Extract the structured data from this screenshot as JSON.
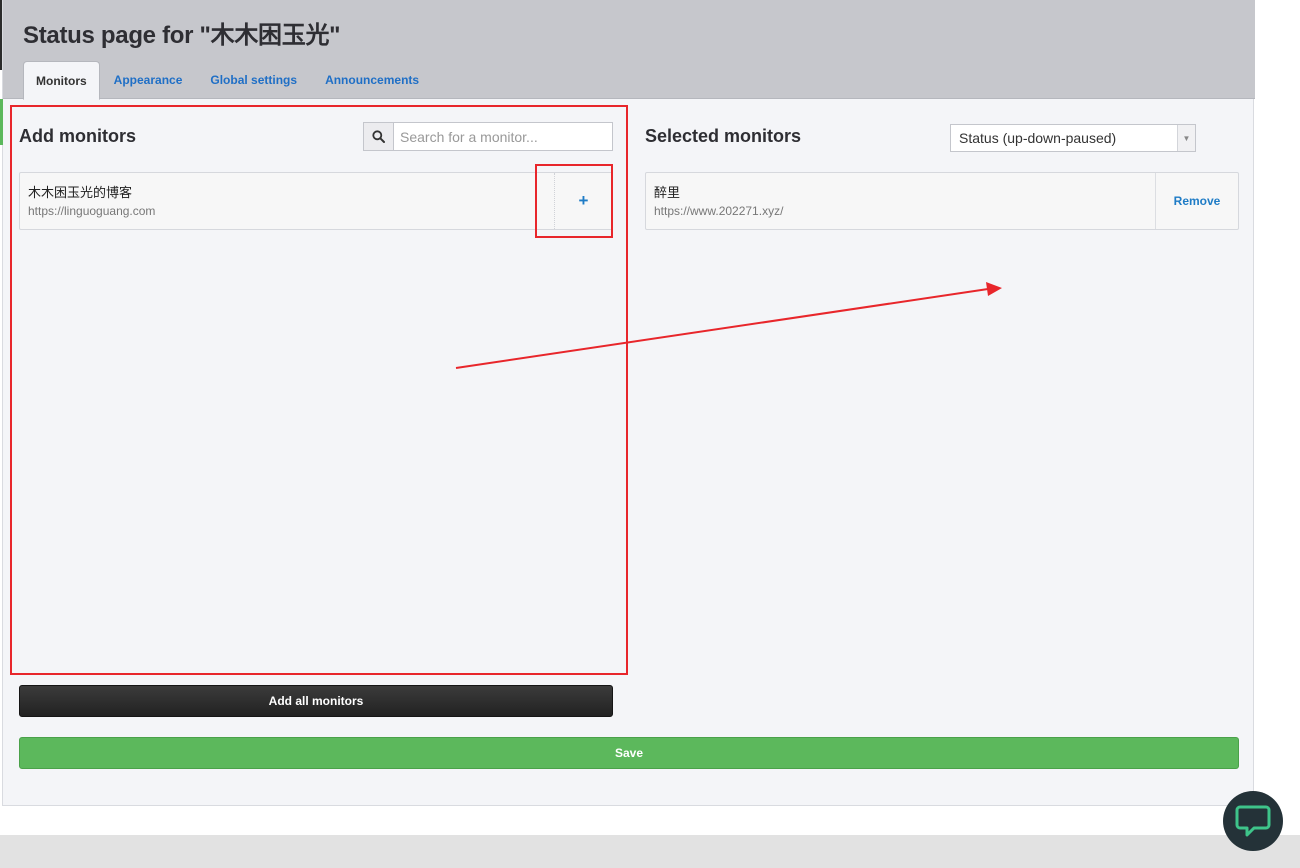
{
  "page": {
    "title": "Status page for \"木木困玉光\""
  },
  "tabs": [
    {
      "label": "Monitors",
      "active": true
    },
    {
      "label": "Appearance",
      "active": false
    },
    {
      "label": "Global settings",
      "active": false
    },
    {
      "label": "Announcements",
      "active": false
    }
  ],
  "add_panel": {
    "title": "Add monitors",
    "search_placeholder": "Search for a monitor...",
    "search_icon": "search-icon",
    "monitors": [
      {
        "name": "木木困玉光的博客",
        "url": "https://linguoguang.com",
        "action_label": "+"
      }
    ],
    "add_all_label": "Add all monitors"
  },
  "selected_panel": {
    "title": "Selected monitors",
    "sort_selected": "Status (up-down-paused)",
    "monitors": [
      {
        "name": "醉里",
        "url": "https://www.202271.xyz/",
        "action_label": "Remove"
      }
    ]
  },
  "save_label": "Save",
  "chat_icon": "chat-bubble-icon",
  "colors": {
    "accent_link": "#1f6fc6",
    "save_green": "#5cb85c",
    "annotation_red": "#e8262b",
    "header_gray": "#c6c7cc"
  }
}
